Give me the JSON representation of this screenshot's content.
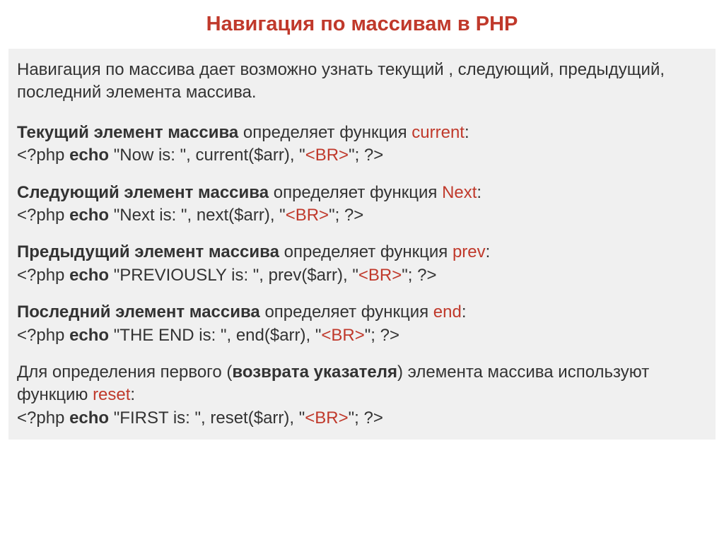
{
  "title": "Навигация по массивам в PHP",
  "intro": "Навигация по массива дает возможно узнать текущий , следующий, предыдущий, последний элемента массива.",
  "sections": {
    "current": {
      "bold": "Текущий элемент массива",
      "rest": " определяет функция ",
      "func": "current",
      "code_prefix": "<?php ",
      "code_echo": "echo",
      "code_mid": " \"Now is: \", current($arr), \"",
      "code_tag": "<BR>",
      "code_suffix": "\"; ?>"
    },
    "next": {
      "bold": "Следующий элемент массива",
      "rest": " определяет функция ",
      "func": "Next",
      "code_prefix": "<?php ",
      "code_echo": "echo",
      "code_mid": " \"Next is: \", next($arr), \"",
      "code_tag": "<BR>",
      "code_suffix": "\"; ?>"
    },
    "prev": {
      "bold": "Предыдущий элемент массива",
      "rest": " определяет функция ",
      "func": "prev",
      "code_prefix": "<?php ",
      "code_echo": "echo",
      "code_mid": " \"PREVIOUSLY is: \", prev($arr), \"",
      "code_tag": "<BR>",
      "code_suffix": "\"; ?>"
    },
    "end": {
      "bold": "Последний элемент массива",
      "rest": "  определяет функция ",
      "func": "end",
      "code_prefix": "<?php ",
      "code_echo": "echo",
      "code_mid": " \"THE END is: \", end($arr), \"",
      "code_tag": "<BR>",
      "code_suffix": "\"; ?>"
    },
    "reset": {
      "pre": "Для определения первого (",
      "bold": "возврата указателя",
      "rest": ") элемента массива используют функцию ",
      "func": "reset",
      "code_prefix": "<?php ",
      "code_echo": "echo",
      "code_mid": " \"FIRST is: \", reset($arr), \"",
      "code_tag": "<BR>",
      "code_suffix": "\"; ?>"
    }
  }
}
